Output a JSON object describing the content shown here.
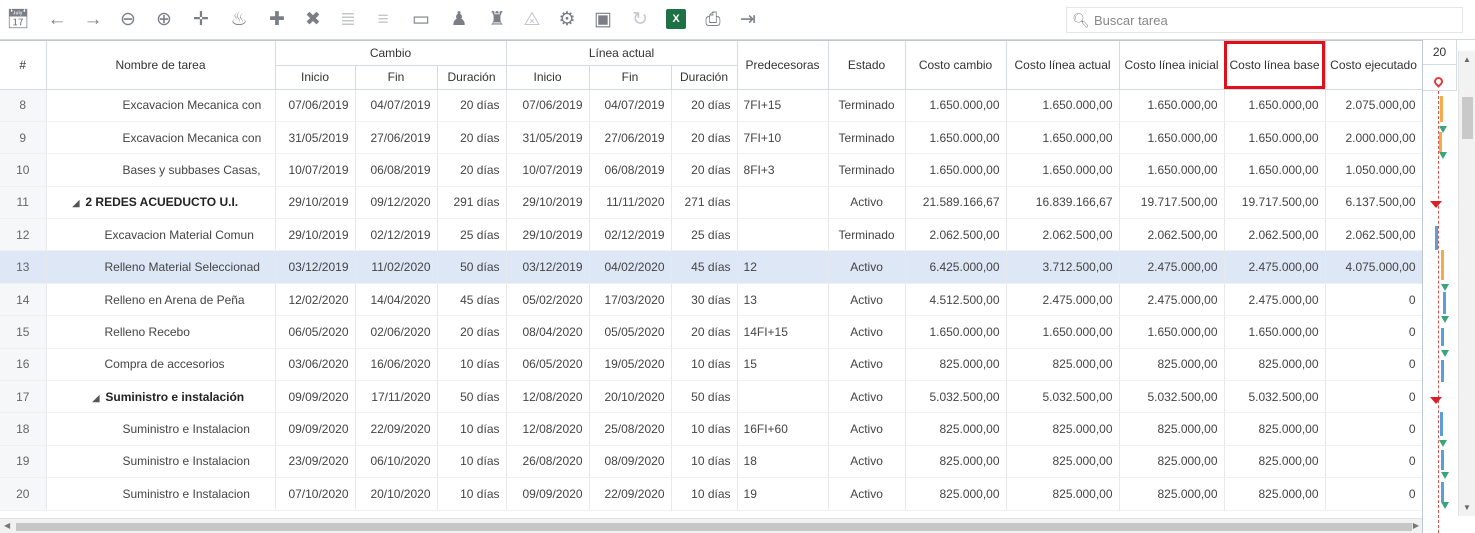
{
  "toolbar": {
    "icons": [
      "calendar-icon",
      "arrow-left-icon",
      "arrow-right-icon",
      "zoom-out-icon",
      "zoom-in-icon",
      "move-icon",
      "fire-icon",
      "add-icon",
      "delete-icon",
      "indent-icon",
      "outdent-icon",
      "link-icon",
      "resources-icon",
      "org-chart-icon",
      "cart-icon",
      "gear-icon",
      "save-icon",
      "refresh-icon",
      "excel-icon",
      "report-icon",
      "exit-icon"
    ],
    "search_placeholder": "Buscar tarea"
  },
  "headers": {
    "num": "#",
    "name": "Nombre de tarea",
    "cambio": "Cambio",
    "linea_actual": "Línea actual",
    "inicio": "Inicio",
    "fin": "Fin",
    "duracion": "Duración",
    "predecesoras": "Predecesoras",
    "estado": "Estado",
    "costo_cambio": "Costo cambio",
    "costo_linea_actual": "Costo línea actual",
    "costo_linea_inicial": "Costo línea inicial",
    "costo_linea_base": "Costo línea base",
    "costo_ejecutado": "Costo ejecutado"
  },
  "gantt": {
    "header": "20"
  },
  "rows": [
    {
      "num": "8",
      "name": "Excavacion Mecanica con",
      "c_ini": "07/06/2019",
      "c_fin": "04/07/2019",
      "c_dur": "20 días",
      "l_ini": "07/06/2019",
      "l_fin": "04/07/2019",
      "l_dur": "20 días",
      "pred": "7FI+15",
      "estado": "Terminado",
      "costo_cambio": "1.650.000,00",
      "costo_actual": "1.650.000,00",
      "costo_inicial": "1.650.000,00",
      "costo_base": "1.650.000,00",
      "costo_ejec": "2.075.000,00"
    },
    {
      "num": "9",
      "name": "Excavacion Mecanica con",
      "c_ini": "31/05/2019",
      "c_fin": "27/06/2019",
      "c_dur": "20 días",
      "l_ini": "31/05/2019",
      "l_fin": "27/06/2019",
      "l_dur": "20 días",
      "pred": "7FI+10",
      "estado": "Terminado",
      "costo_cambio": "1.650.000,00",
      "costo_actual": "1.650.000,00",
      "costo_inicial": "1.650.000,00",
      "costo_base": "1.650.000,00",
      "costo_ejec": "2.000.000,00"
    },
    {
      "num": "10",
      "name": "Bases y subbases Casas,",
      "c_ini": "10/07/2019",
      "c_fin": "06/08/2019",
      "c_dur": "20 días",
      "l_ini": "10/07/2019",
      "l_fin": "06/08/2019",
      "l_dur": "20 días",
      "pred": "8FI+3",
      "estado": "Terminado",
      "costo_cambio": "1.650.000,00",
      "costo_actual": "1.650.000,00",
      "costo_inicial": "1.650.000,00",
      "costo_base": "1.650.000,00",
      "costo_ejec": "1.050.000,00"
    },
    {
      "num": "11",
      "name": "2 REDES ACUEDUCTO U.I.",
      "c_ini": "29/10/2019",
      "c_fin": "09/12/2020",
      "c_dur": "291 días",
      "l_ini": "29/10/2019",
      "l_fin": "11/11/2020",
      "l_dur": "271 días",
      "pred": "",
      "estado": "Activo",
      "costo_cambio": "21.589.166,67",
      "costo_actual": "16.839.166,67",
      "costo_inicial": "19.717.500,00",
      "costo_base": "19.717.500,00",
      "costo_ejec": "6.137.500,00"
    },
    {
      "num": "12",
      "name": "Excavacion Material Comun",
      "c_ini": "29/10/2019",
      "c_fin": "02/12/2019",
      "c_dur": "25 días",
      "l_ini": "29/10/2019",
      "l_fin": "02/12/2019",
      "l_dur": "25 días",
      "pred": "",
      "estado": "Terminado",
      "costo_cambio": "2.062.500,00",
      "costo_actual": "2.062.500,00",
      "costo_inicial": "2.062.500,00",
      "costo_base": "2.062.500,00",
      "costo_ejec": "2.062.500,00"
    },
    {
      "num": "13",
      "name": "Relleno Material Seleccionad",
      "c_ini": "03/12/2019",
      "c_fin": "11/02/2020",
      "c_dur": "50 días",
      "l_ini": "03/12/2019",
      "l_fin": "04/02/2020",
      "l_dur": "45 días",
      "pred": "12",
      "estado": "Activo",
      "costo_cambio": "6.425.000,00",
      "costo_actual": "3.712.500,00",
      "costo_inicial": "2.475.000,00",
      "costo_base": "2.475.000,00",
      "costo_ejec": "4.075.000,00"
    },
    {
      "num": "14",
      "name": "Relleno en Arena de Peña",
      "c_ini": "12/02/2020",
      "c_fin": "14/04/2020",
      "c_dur": "45 días",
      "l_ini": "05/02/2020",
      "l_fin": "17/03/2020",
      "l_dur": "30 días",
      "pred": "13",
      "estado": "Activo",
      "costo_cambio": "4.512.500,00",
      "costo_actual": "2.475.000,00",
      "costo_inicial": "2.475.000,00",
      "costo_base": "2.475.000,00",
      "costo_ejec": "0"
    },
    {
      "num": "15",
      "name": "Relleno Recebo",
      "c_ini": "06/05/2020",
      "c_fin": "02/06/2020",
      "c_dur": "20 días",
      "l_ini": "08/04/2020",
      "l_fin": "05/05/2020",
      "l_dur": "20 días",
      "pred": "14FI+15",
      "estado": "Activo",
      "costo_cambio": "1.650.000,00",
      "costo_actual": "1.650.000,00",
      "costo_inicial": "1.650.000,00",
      "costo_base": "1.650.000,00",
      "costo_ejec": "0"
    },
    {
      "num": "16",
      "name": "Compra de accesorios",
      "c_ini": "03/06/2020",
      "c_fin": "16/06/2020",
      "c_dur": "10 días",
      "l_ini": "06/05/2020",
      "l_fin": "19/05/2020",
      "l_dur": "10 días",
      "pred": "15",
      "estado": "Activo",
      "costo_cambio": "825.000,00",
      "costo_actual": "825.000,00",
      "costo_inicial": "825.000,00",
      "costo_base": "825.000,00",
      "costo_ejec": "0"
    },
    {
      "num": "17",
      "name": "Suministro e instalación",
      "c_ini": "09/09/2020",
      "c_fin": "17/11/2020",
      "c_dur": "50 días",
      "l_ini": "12/08/2020",
      "l_fin": "20/10/2020",
      "l_dur": "50 días",
      "pred": "",
      "estado": "Activo",
      "costo_cambio": "5.032.500,00",
      "costo_actual": "5.032.500,00",
      "costo_inicial": "5.032.500,00",
      "costo_base": "5.032.500,00",
      "costo_ejec": "0"
    },
    {
      "num": "18",
      "name": "Suministro e Instalacion",
      "c_ini": "09/09/2020",
      "c_fin": "22/09/2020",
      "c_dur": "10 días",
      "l_ini": "12/08/2020",
      "l_fin": "25/08/2020",
      "l_dur": "10 días",
      "pred": "16FI+60",
      "estado": "Activo",
      "costo_cambio": "825.000,00",
      "costo_actual": "825.000,00",
      "costo_inicial": "825.000,00",
      "costo_base": "825.000,00",
      "costo_ejec": "0"
    },
    {
      "num": "19",
      "name": "Suministro e Instalacion",
      "c_ini": "23/09/2020",
      "c_fin": "06/10/2020",
      "c_dur": "10 días",
      "l_ini": "26/08/2020",
      "l_fin": "08/09/2020",
      "l_dur": "10 días",
      "pred": "18",
      "estado": "Activo",
      "costo_cambio": "825.000,00",
      "costo_actual": "825.000,00",
      "costo_inicial": "825.000,00",
      "costo_base": "825.000,00",
      "costo_ejec": "0"
    },
    {
      "num": "20",
      "name": "Suministro e Instalacion",
      "c_ini": "07/10/2020",
      "c_fin": "20/10/2020",
      "c_dur": "10 días",
      "l_ini": "09/09/2020",
      "l_fin": "22/09/2020",
      "l_dur": "10 días",
      "pred": "19",
      "estado": "Activo",
      "costo_cambio": "825.000,00",
      "costo_actual": "825.000,00",
      "costo_inicial": "825.000,00",
      "costo_base": "825.000,00",
      "costo_ejec": "0"
    }
  ]
}
